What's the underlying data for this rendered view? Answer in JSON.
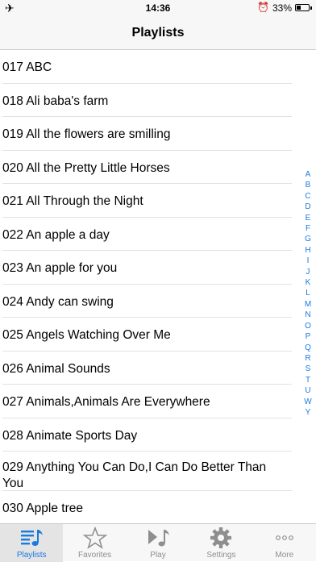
{
  "status_bar": {
    "time": "14:36",
    "battery_percent": "33%",
    "battery_level": 0.33
  },
  "nav": {
    "title": "Playlists"
  },
  "playlists": [
    "017 ABC",
    "018 Ali baba's farm",
    "019 All the flowers are smilling",
    "020 All the Pretty Little Horses",
    "021 All Through the Night",
    "022 An apple a day",
    "023 An apple for you",
    "024 Andy can swing",
    "025 Angels Watching Over Me",
    "026 Animal Sounds",
    "027 Animals,Animals Are Everywhere",
    "028 Animate Sports Day",
    "029 Anything You Can Do,I Can Do Better Than You",
    "030 Apple tree"
  ],
  "index_letters": [
    "A",
    "B",
    "C",
    "D",
    "E",
    "F",
    "G",
    "H",
    "I",
    "J",
    "K",
    "L",
    "M",
    "N",
    "O",
    "P",
    "Q",
    "R",
    "S",
    "T",
    "U",
    "W",
    "Y"
  ],
  "tabs": {
    "playlists": "Playlists",
    "favorites": "Favorites",
    "play": "Play",
    "settings": "Settings",
    "more": "More"
  },
  "colors": {
    "accent": "#1a7ae0",
    "inactive": "#8e8e8e"
  }
}
